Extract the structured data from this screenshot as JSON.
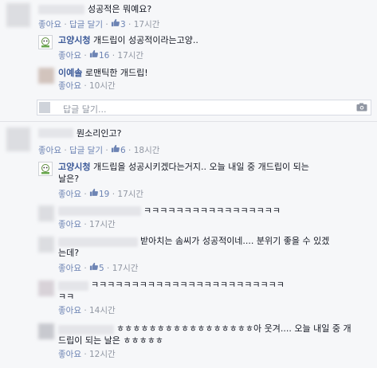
{
  "c1": {
    "text": "성공적은 뭐예요?",
    "like": "좋아요",
    "reply": "답글 달기",
    "count": "3",
    "time": "17시간"
  },
  "c1r1": {
    "name": "고양시청",
    "text": "개드립이 성공적이라는고양..",
    "like": "좋아요",
    "count": "16",
    "time": "17시간"
  },
  "c1r2": {
    "name": "이예솔",
    "text": "로맨틱한 개드립!",
    "like": "좋아요",
    "time": "10시간"
  },
  "reply_box_1": {
    "placeholder": "답글 달기..."
  },
  "c2": {
    "text": "뭔소리인고?",
    "like": "좋아요",
    "reply": "답글 달기",
    "count": "6",
    "time": "18시간"
  },
  "c2r1": {
    "name": "고양시청",
    "text": "개드립을 성공시키겠다는거지.. 오늘 내일 중 개드립이 되는",
    "text2": "날은?",
    "like": "좋아요",
    "count": "19",
    "time": "17시간"
  },
  "c2r2": {
    "text": "ㅋㅋㅋㅋㅋㅋㅋㅋㅋㅋㅋㅋㅋㅋㅋㅋㅋ",
    "like": "좋아요",
    "time": "17시간"
  },
  "c2r3": {
    "text": "받아치는 솜씨가 성공적이네.... 분위기 좋을 수 있겠",
    "text2": "는데?",
    "like": "좋아요",
    "count": "5",
    "time": "17시간"
  },
  "c2r4": {
    "text": "ㅋㅋㅋㅋㅋㅋㅋㅋㅋㅋㅋㅋㅋㅋㅋㅋㅋㅋㅋㅋㅋㅋㅋㅋ",
    "text2": "ㅋㅋ",
    "like": "좋아요",
    "time": "14시간"
  },
  "c2r5": {
    "text": "ㅎㅎㅎㅎㅎㅎㅎㅎㅎㅎㅎㅎㅎㅎㅎㅎㅎ아 웃겨.... 오늘 내일 중 개",
    "text2": "드립이 되는 날은 ㅎㅎㅎㅎㅎ",
    "like": "좋아요",
    "time": "12시간"
  },
  "icons": {
    "thumb": "thumbs-up-icon",
    "camera": "camera-icon",
    "logo": "goyang-city-logo"
  }
}
